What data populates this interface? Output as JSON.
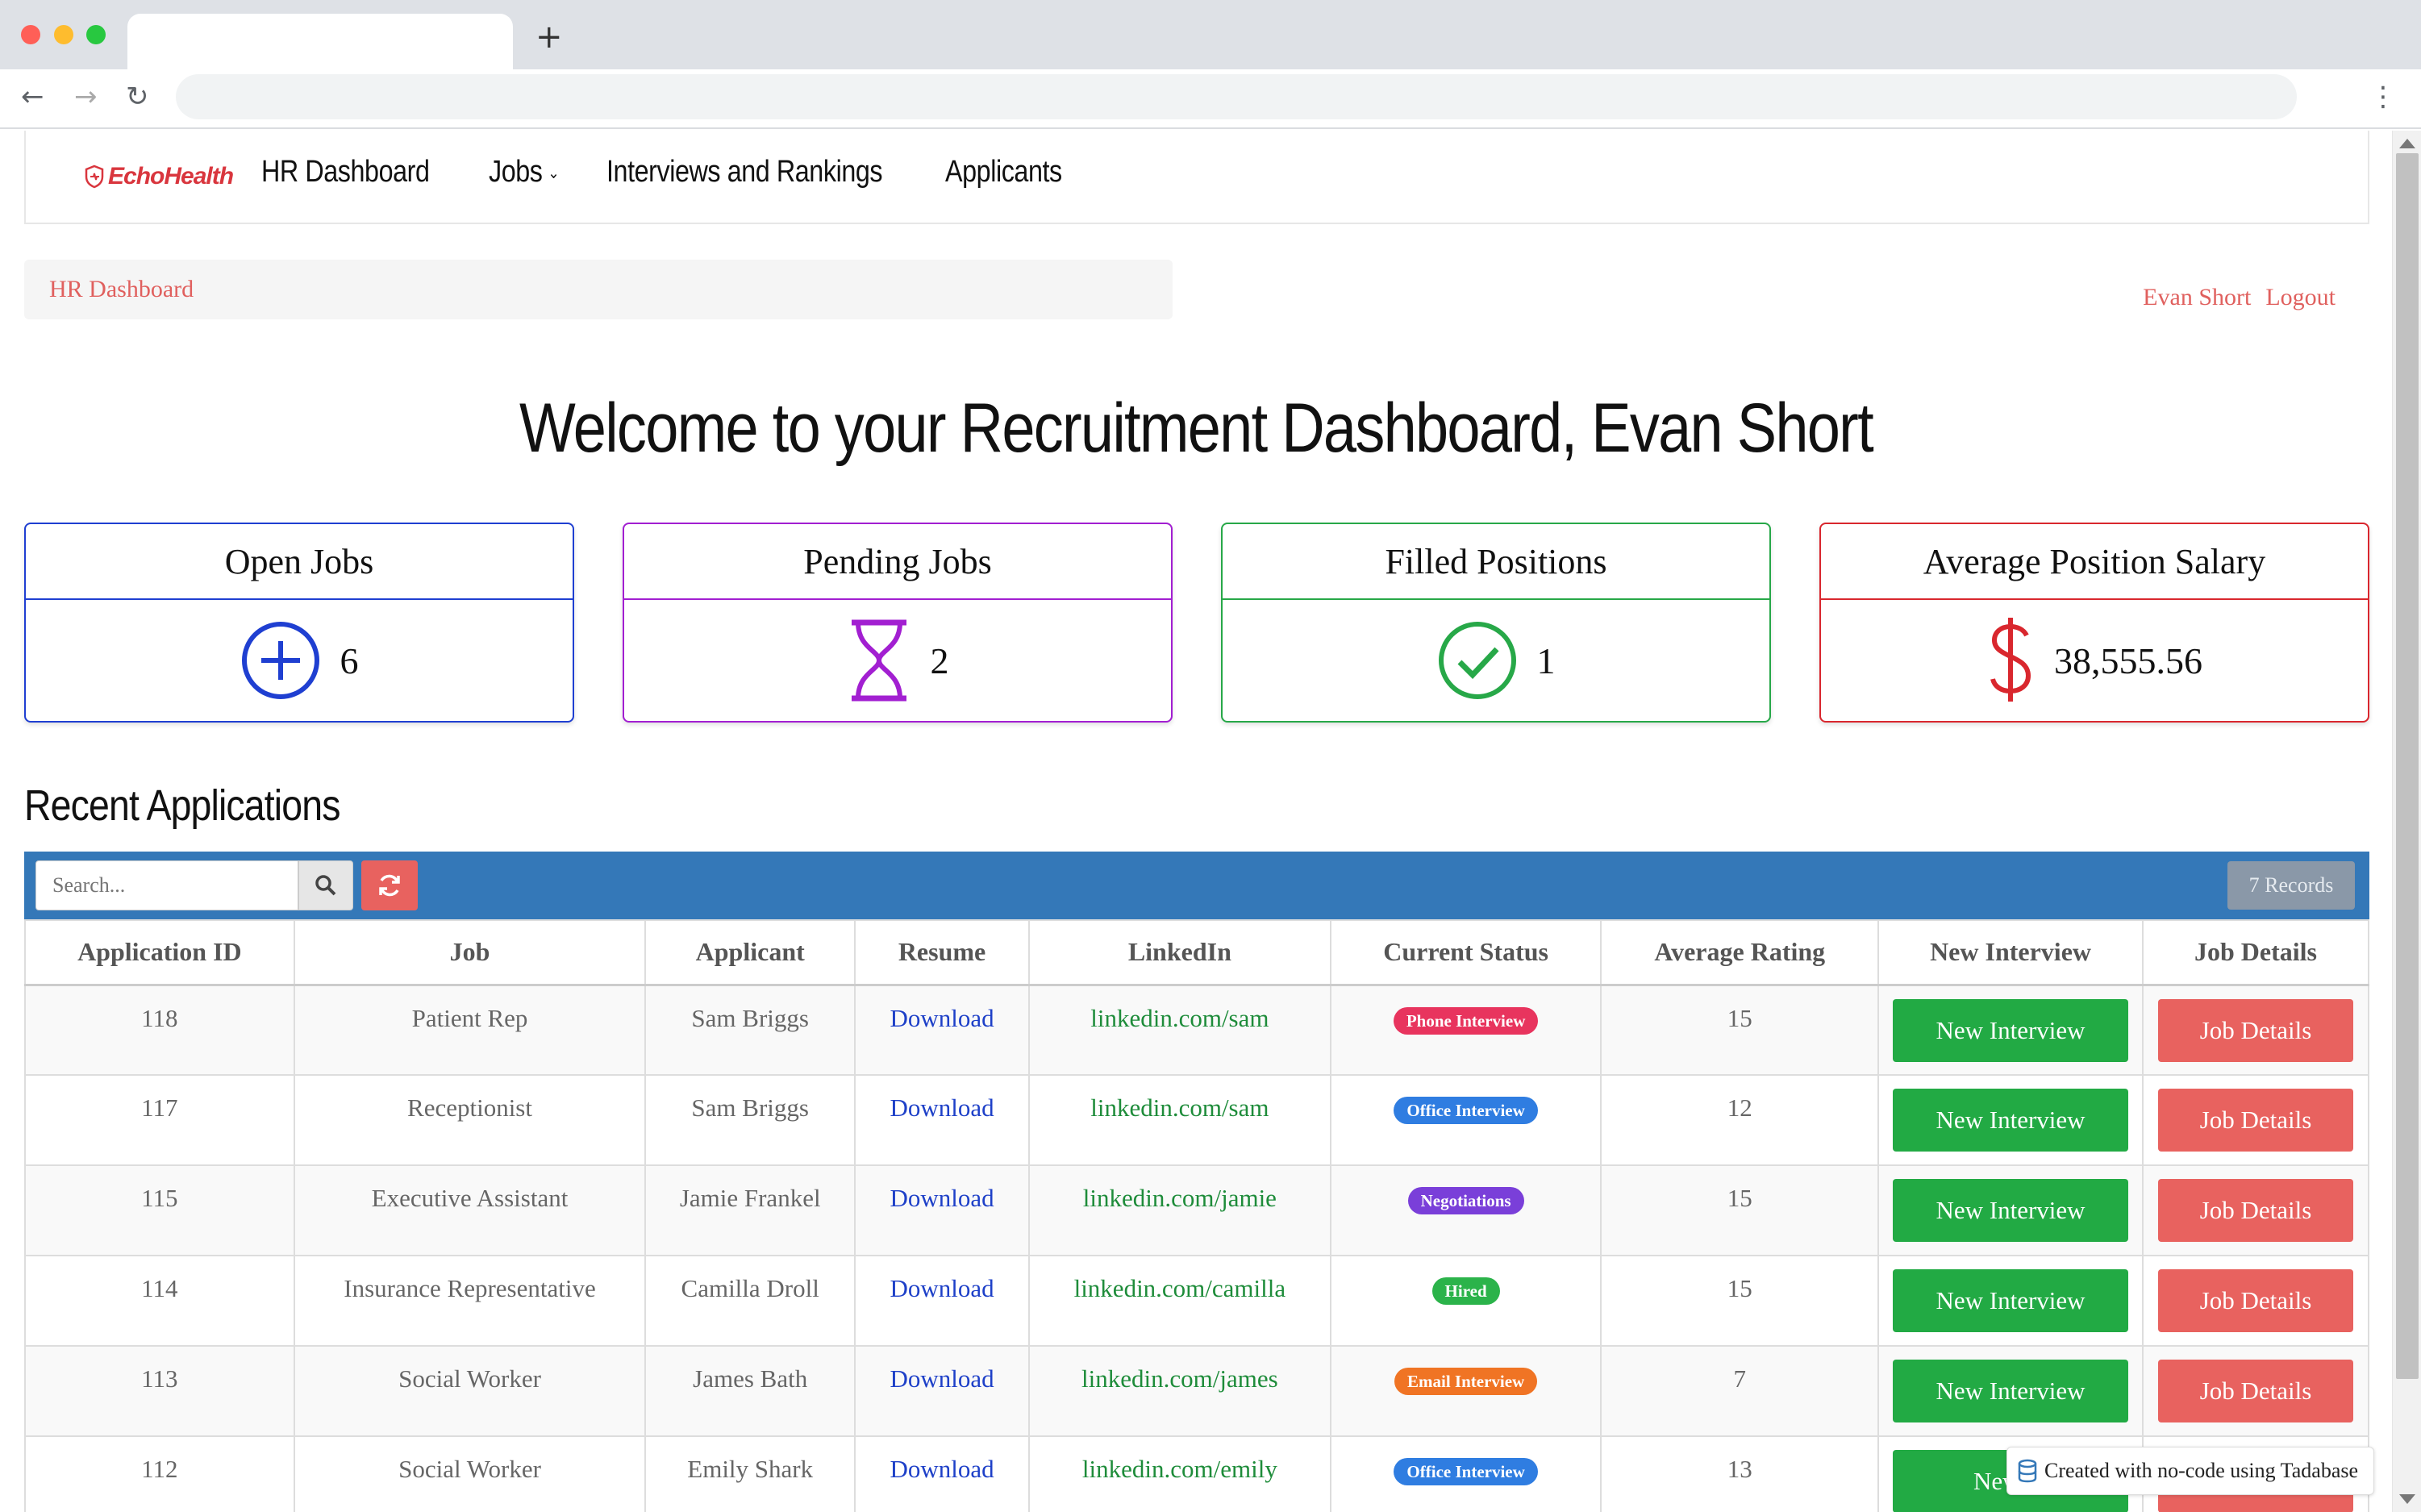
{
  "browser": {
    "new_tab": "+",
    "back": "←",
    "forward": "→",
    "reload": "↻",
    "menu": "⋮"
  },
  "nav": {
    "logo": "EchoHealth",
    "items": [
      {
        "label": "HR Dashboard"
      },
      {
        "label": "Jobs"
      },
      {
        "label": "Interviews and Rankings"
      },
      {
        "label": "Applicants"
      }
    ]
  },
  "breadcrumb": "HR Dashboard",
  "user": {
    "name": "Evan Short",
    "logout": "Logout"
  },
  "welcome": "Welcome to your Recruitment Dashboard, Evan Short",
  "stats": [
    {
      "title": "Open Jobs",
      "value": "6",
      "color": "#1f3fd1",
      "icon": "plus-circle-icon"
    },
    {
      "title": "Pending Jobs",
      "value": "2",
      "color": "#a21fd1",
      "icon": "hourglass-icon"
    },
    {
      "title": "Filled Positions",
      "value": "1",
      "color": "#27a848",
      "icon": "check-circle-icon"
    },
    {
      "title": "Average Position Salary",
      "value": "38,555.56",
      "color": "#d9272e",
      "icon": "dollar-icon"
    }
  ],
  "recent": {
    "title": "Recent Applications",
    "search_placeholder": "Search...",
    "records": "7 Records",
    "columns": [
      "Application ID",
      "Job",
      "Applicant",
      "Resume",
      "LinkedIn",
      "Current Status",
      "Average Rating",
      "New Interview",
      "Job Details"
    ],
    "rows": [
      {
        "id": "118",
        "job": "Patient Rep",
        "applicant": "Sam Briggs",
        "resume": "Download",
        "linkedin": "linkedin.com/sam",
        "status": "Phone Interview",
        "status_color": "#e8345e",
        "rating": "15",
        "new_interview": "New Interview",
        "job_details": "Job Details"
      },
      {
        "id": "117",
        "job": "Receptionist",
        "applicant": "Sam Briggs",
        "resume": "Download",
        "linkedin": "linkedin.com/sam",
        "status": "Office Interview",
        "status_color": "#2f7de1",
        "rating": "12",
        "new_interview": "New Interview",
        "job_details": "Job Details"
      },
      {
        "id": "115",
        "job": "Executive Assistant",
        "applicant": "Jamie Frankel",
        "resume": "Download",
        "linkedin": "linkedin.com/jamie",
        "status": "Negotiations",
        "status_color": "#7a3fd9",
        "rating": "15",
        "new_interview": "New Interview",
        "job_details": "Job Details"
      },
      {
        "id": "114",
        "job": "Insurance Representative",
        "applicant": "Camilla Droll",
        "resume": "Download",
        "linkedin": "linkedin.com/camilla",
        "status": "Hired",
        "status_color": "#2bb34a",
        "rating": "15",
        "new_interview": "New Interview",
        "job_details": "Job Details"
      },
      {
        "id": "113",
        "job": "Social Worker",
        "applicant": "James Bath",
        "resume": "Download",
        "linkedin": "linkedin.com/james",
        "status": "Email Interview",
        "status_color": "#f07424",
        "rating": "7",
        "new_interview": "New Interview",
        "job_details": "Job Details"
      },
      {
        "id": "112",
        "job": "Social Worker",
        "applicant": "Emily Shark",
        "resume": "Download",
        "linkedin": "linkedin.com/emily",
        "status": "Office Interview",
        "status_color": "#2f7de1",
        "rating": "13",
        "new_interview": "New In",
        "job_details": "Job Details"
      }
    ]
  },
  "footer_badge": "Created with no-code using Tadabase"
}
